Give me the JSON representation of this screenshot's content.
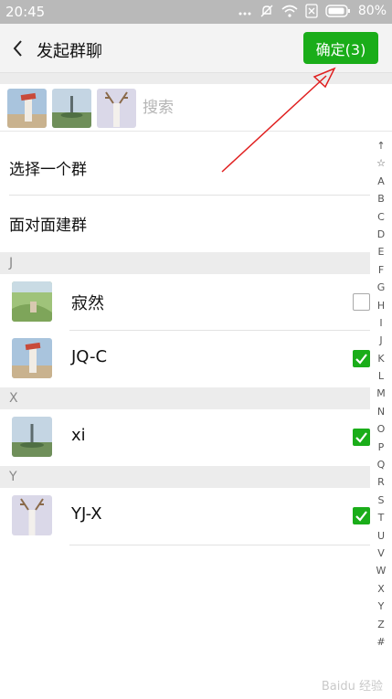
{
  "status_bar": {
    "time": "20:45",
    "battery": "80%"
  },
  "header": {
    "title": "发起群聊",
    "confirm_label": "确定(3)"
  },
  "search": {
    "placeholder": "搜索"
  },
  "selected_avatars": [
    "lighthouse-photo",
    "tower-photo",
    "deer-photo"
  ],
  "options": [
    {
      "label": "选择一个群"
    },
    {
      "label": "面对面建群"
    }
  ],
  "sections": [
    {
      "letter": "J",
      "contacts": [
        {
          "name": "寂然",
          "checked": false
        },
        {
          "name": "JQ-C",
          "checked": true
        }
      ]
    },
    {
      "letter": "X",
      "contacts": [
        {
          "name": "xi",
          "checked": true
        }
      ]
    },
    {
      "letter": "Y",
      "contacts": [
        {
          "name": "YJ-X",
          "checked": true
        }
      ]
    }
  ],
  "index_letters": [
    "↑",
    "☆",
    "A",
    "B",
    "C",
    "D",
    "E",
    "F",
    "G",
    "H",
    "I",
    "J",
    "K",
    "L",
    "M",
    "N",
    "O",
    "P",
    "Q",
    "R",
    "S",
    "T",
    "U",
    "V",
    "W",
    "X",
    "Y",
    "Z",
    "#"
  ],
  "colors": {
    "accent": "#1aad19",
    "annotation": "#e02020"
  },
  "watermark": "Baidu 经验"
}
